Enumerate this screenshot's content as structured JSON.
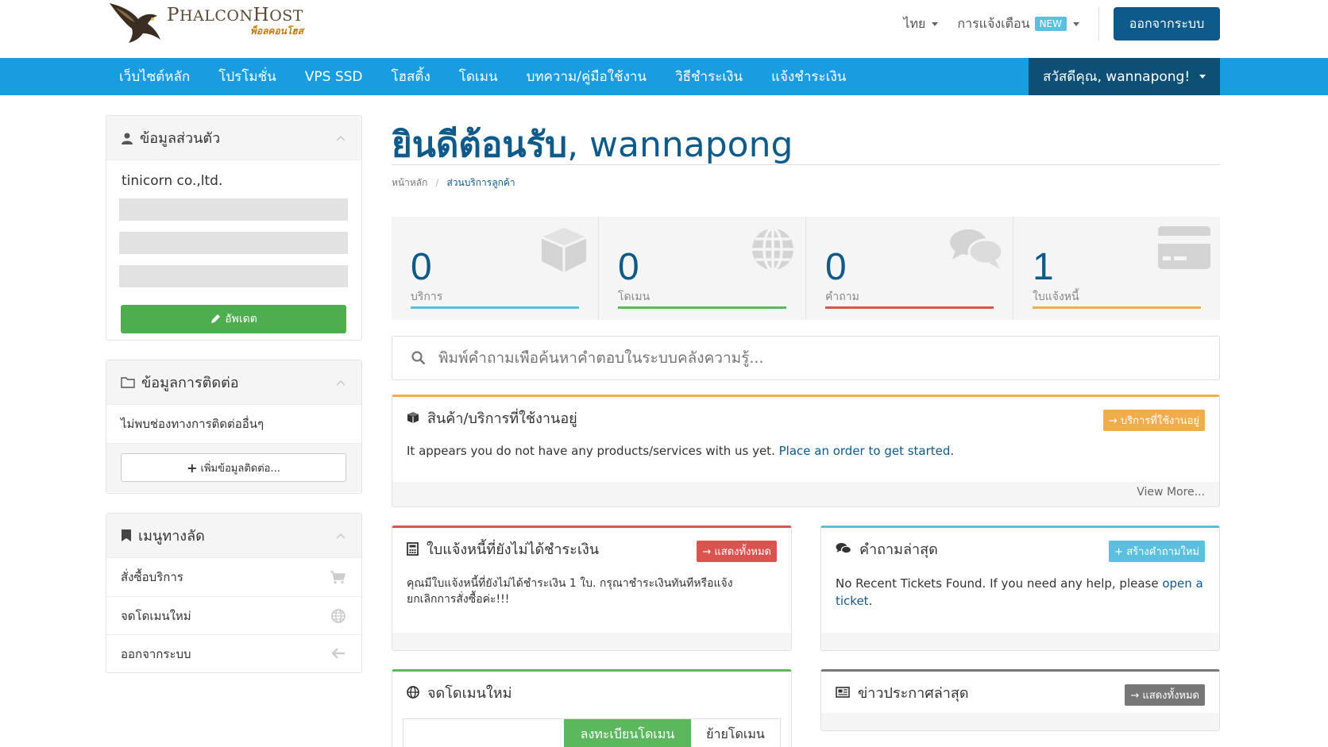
{
  "brand": {
    "name_first": "P",
    "name_rest": "HALCON",
    "name_first2": "H",
    "name_rest2": "OST",
    "tagline": "พ็อลคอนโฮส"
  },
  "header": {
    "language": "ไทย",
    "notifications": "การแจ้งเตือน",
    "new_badge": "NEW",
    "logout": "ออกจากระบบ"
  },
  "nav": {
    "items": [
      {
        "label": "เว็บไซต์หลัก"
      },
      {
        "label": "โปรโมชั่น"
      },
      {
        "label": "VPS SSD"
      },
      {
        "label": "โฮสติ้ง"
      },
      {
        "label": "โดเมน"
      },
      {
        "label": "บทความ/คู่มือใช้งาน"
      },
      {
        "label": "วิธีชำระเงิน"
      },
      {
        "label": "แจ้งชำระเงิน"
      }
    ],
    "user": "สวัสดีคุณ, wannapong!"
  },
  "sidebar": {
    "profile": {
      "title": "ข้อมูลส่วนตัว",
      "company": "tinicorn co.,ltd.",
      "update": "อัพเดต"
    },
    "contacts": {
      "title": "ข้อมูลการติดต่อ",
      "empty": "ไม่พบช่องทางการติดต่ออื่นๆ",
      "add": "เพิ่มข้อมูลติดต่อ..."
    },
    "shortcuts": {
      "title": "เมนูทางลัด",
      "items": [
        {
          "label": "สั่งซื้อบริการ",
          "icon": "cart-icon"
        },
        {
          "label": "จดโดเมนใหม่",
          "icon": "globe-icon"
        },
        {
          "label": "ออกจากระบบ",
          "icon": "arrow-left-icon"
        }
      ]
    }
  },
  "main": {
    "title_thai": "ยินดีต้อนรับ",
    "title_name": ", wannapong",
    "breadcrumb": {
      "home": "หน้าหลัก",
      "sep": "/",
      "current": "ส่วนบริการลูกค้า"
    },
    "stats": [
      {
        "value": "0",
        "label": "บริการ",
        "color": "#5bc0de",
        "icon": "cube-icon"
      },
      {
        "value": "0",
        "label": "โดเมน",
        "color": "#5cb85c",
        "icon": "globe-icon"
      },
      {
        "value": "0",
        "label": "คำถาม",
        "color": "#d9534f",
        "icon": "comments-icon"
      },
      {
        "value": "1",
        "label": "ใบแจ้งหนี้",
        "color": "#f0ad4e",
        "icon": "credit-card-icon"
      }
    ],
    "search_placeholder": "พิมพ์คำถามเพื่อค้นหาคำตอบในระบบคลังความรู้...",
    "products": {
      "title": "สินค้า/บริการที่ใช้งานอยู่",
      "badge": "บริการที่ใช้งานอยู่",
      "text": "It appears you do not have any products/services with us yet. ",
      "link": "Place an order to get started",
      "end": ".",
      "more": "View More..."
    },
    "invoices": {
      "title": "ใบแจ้งหนี้ที่ยังไม่ได้ชำระเงิน",
      "badge": "แสดงทั้งหมด",
      "text": "คุณมีใบแจ้งหนี้ที่ยังไม่ได้ชำระเงิน 1 ใบ. กรุณาชำระเงินทันทีหรือแจ้งยกเลิกการสั่งซื้อค่ะ!!!"
    },
    "tickets": {
      "title": "คำถามล่าสุด",
      "badge": "สร้างคำถามใหม่",
      "text": "No Recent Tickets Found. If you need any help, please ",
      "link": "open a ticket",
      "end": "."
    },
    "register": {
      "title": "จดโดเมนใหม่",
      "tab_register": "ลงทะเบียนโดเมน",
      "tab_transfer": "ย้ายโดเมน"
    },
    "news": {
      "title": "ข่าวประกาศล่าสุด",
      "badge": "แสดงทั้งหมด"
    }
  }
}
